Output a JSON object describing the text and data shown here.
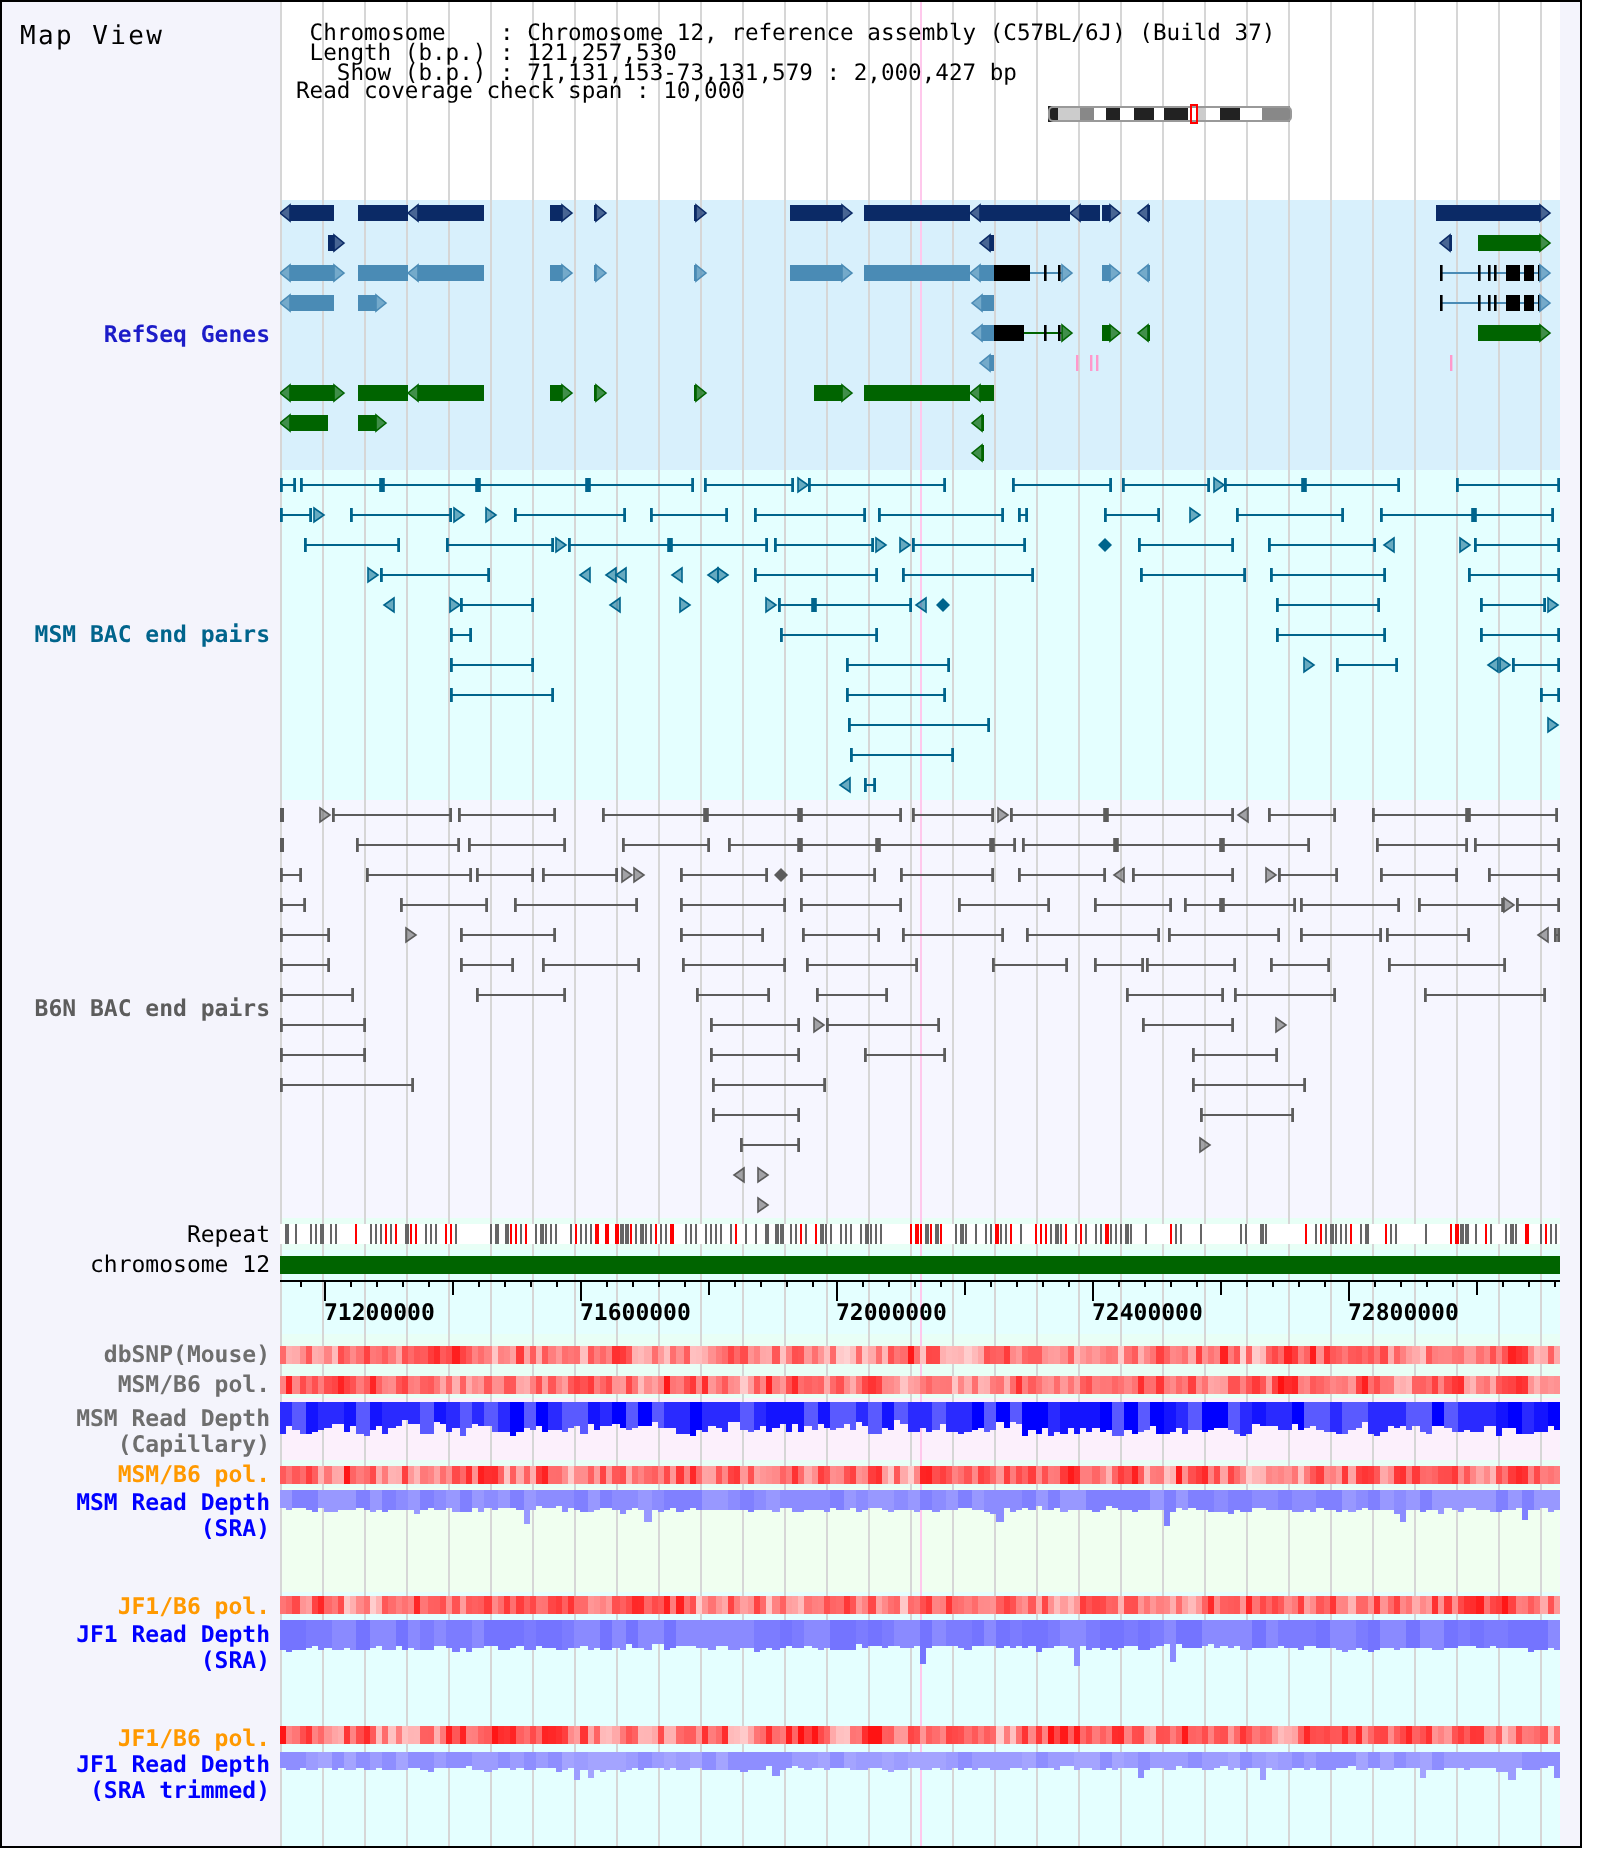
{
  "title": "Map View",
  "header": {
    "lines": [
      "Chromosome    : Chromosome 12, reference assembly (C57BL/6J) (Build 37)",
      "Length (b.p.) : 121,257,530",
      "Show (b.p.) : 71,131,153-73,131,579 : 2,000,427 bp",
      "Read coverage check span : 10,000"
    ]
  },
  "tracks": [
    {
      "kind": "genes",
      "label": "RefSeq Genes",
      "color": "#1c1cc8"
    },
    {
      "kind": "bac_pairs",
      "label": "MSM BAC end pairs",
      "color": "#00648c"
    },
    {
      "kind": "bac_pairs",
      "label": "B6N BAC end pairs",
      "color": "#5c5c5c"
    },
    {
      "kind": "repeat",
      "label": "Repeat",
      "color": "#000000"
    },
    {
      "kind": "chromosome",
      "label": "chromosome 12",
      "color": "#000000"
    },
    {
      "kind": "axis",
      "labels": [
        "71200000",
        "71600000",
        "72000000",
        "72400000",
        "72800000"
      ]
    },
    {
      "kind": "heat",
      "label": "dbSNP(Mouse)",
      "color": "#6e6e6e"
    },
    {
      "kind": "heat",
      "label": "MSM/B6 pol.",
      "color": "#6e6e6e"
    },
    {
      "kind": "depth",
      "label": "MSM Read Depth (Capillary)",
      "color": "#6e6e6e"
    },
    {
      "kind": "heat",
      "label": "MSM/B6 pol.",
      "color": "#ff9900"
    },
    {
      "kind": "depth",
      "label": "MSM Read Depth (SRA)",
      "color": "#0000ff"
    },
    {
      "kind": "heat",
      "label": "JF1/B6 pol.",
      "color": "#ff9900"
    },
    {
      "kind": "depth",
      "label": "JF1 Read Depth (SRA)",
      "color": "#0000ff"
    },
    {
      "kind": "heat",
      "label": "JF1/B6 pol.",
      "color": "#ff9900"
    },
    {
      "kind": "depth",
      "label": "JF1 Read Depth (SRA trimmed)",
      "color": "#0000ff"
    }
  ]
}
